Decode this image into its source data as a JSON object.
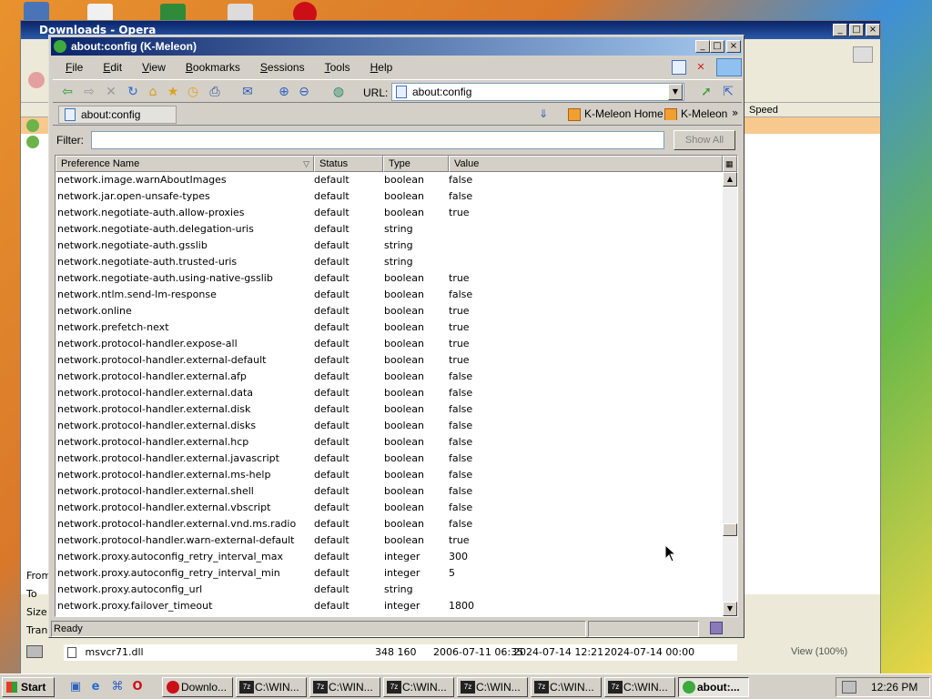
{
  "opera": {
    "title": "Downloads - Opera",
    "left_labels": [
      "From",
      "To",
      "Size",
      "Tran"
    ],
    "speed_header": "Speed",
    "zoom": "View (100%)",
    "file_row": {
      "name": "msvcr71.dll",
      "size": "348 160",
      "date1": "2006-07-11 06:35",
      "date2": "2024-07-14 12:21",
      "date3": "2024-07-14 00:00"
    }
  },
  "kmeleon": {
    "title": "about:config (K-Meleon)",
    "menu": [
      "File",
      "Edit",
      "View",
      "Bookmarks",
      "Sessions",
      "Tools",
      "Help"
    ],
    "url_label": "URL:",
    "url_value": "about:config",
    "tab_label": "about:config",
    "bookmarks": [
      "K-Meleon Home",
      "K-Meleon Fi"
    ],
    "filter_label": "Filter:",
    "filter_value": "",
    "show_all": "Show All",
    "columns": [
      "Preference Name",
      "Status",
      "Type",
      "Value"
    ],
    "status_text": "Ready",
    "prefs": [
      {
        "name": "network.image.warnAboutImages",
        "status": "default",
        "type": "boolean",
        "value": "false"
      },
      {
        "name": "network.jar.open-unsafe-types",
        "status": "default",
        "type": "boolean",
        "value": "false"
      },
      {
        "name": "network.negotiate-auth.allow-proxies",
        "status": "default",
        "type": "boolean",
        "value": "true"
      },
      {
        "name": "network.negotiate-auth.delegation-uris",
        "status": "default",
        "type": "string",
        "value": ""
      },
      {
        "name": "network.negotiate-auth.gsslib",
        "status": "default",
        "type": "string",
        "value": ""
      },
      {
        "name": "network.negotiate-auth.trusted-uris",
        "status": "default",
        "type": "string",
        "value": ""
      },
      {
        "name": "network.negotiate-auth.using-native-gsslib",
        "status": "default",
        "type": "boolean",
        "value": "true"
      },
      {
        "name": "network.ntlm.send-lm-response",
        "status": "default",
        "type": "boolean",
        "value": "false"
      },
      {
        "name": "network.online",
        "status": "default",
        "type": "boolean",
        "value": "true"
      },
      {
        "name": "network.prefetch-next",
        "status": "default",
        "type": "boolean",
        "value": "true"
      },
      {
        "name": "network.protocol-handler.expose-all",
        "status": "default",
        "type": "boolean",
        "value": "true"
      },
      {
        "name": "network.protocol-handler.external-default",
        "status": "default",
        "type": "boolean",
        "value": "true"
      },
      {
        "name": "network.protocol-handler.external.afp",
        "status": "default",
        "type": "boolean",
        "value": "false"
      },
      {
        "name": "network.protocol-handler.external.data",
        "status": "default",
        "type": "boolean",
        "value": "false"
      },
      {
        "name": "network.protocol-handler.external.disk",
        "status": "default",
        "type": "boolean",
        "value": "false"
      },
      {
        "name": "network.protocol-handler.external.disks",
        "status": "default",
        "type": "boolean",
        "value": "false"
      },
      {
        "name": "network.protocol-handler.external.hcp",
        "status": "default",
        "type": "boolean",
        "value": "false"
      },
      {
        "name": "network.protocol-handler.external.javascript",
        "status": "default",
        "type": "boolean",
        "value": "false"
      },
      {
        "name": "network.protocol-handler.external.ms-help",
        "status": "default",
        "type": "boolean",
        "value": "false"
      },
      {
        "name": "network.protocol-handler.external.shell",
        "status": "default",
        "type": "boolean",
        "value": "false"
      },
      {
        "name": "network.protocol-handler.external.vbscript",
        "status": "default",
        "type": "boolean",
        "value": "false"
      },
      {
        "name": "network.protocol-handler.external.vnd.ms.radio",
        "status": "default",
        "type": "boolean",
        "value": "false"
      },
      {
        "name": "network.protocol-handler.warn-external-default",
        "status": "default",
        "type": "boolean",
        "value": "true"
      },
      {
        "name": "network.proxy.autoconfig_retry_interval_max",
        "status": "default",
        "type": "integer",
        "value": "300"
      },
      {
        "name": "network.proxy.autoconfig_retry_interval_min",
        "status": "default",
        "type": "integer",
        "value": "5"
      },
      {
        "name": "network.proxy.autoconfig_url",
        "status": "default",
        "type": "string",
        "value": ""
      },
      {
        "name": "network.proxy.failover_timeout",
        "status": "default",
        "type": "integer",
        "value": "1800"
      }
    ]
  },
  "taskbar": {
    "start": "Start",
    "tasks": [
      "Downlo...",
      "C:\\WIN...",
      "C:\\WIN...",
      "C:\\WIN...",
      "C:\\WIN...",
      "C:\\WIN...",
      "C:\\WIN...",
      "about:..."
    ],
    "clock": "12:26 PM"
  },
  "colors": {
    "title_active": "#0a246a",
    "window_face": "#d4d0c8",
    "opera_red": "#cc0f16"
  }
}
